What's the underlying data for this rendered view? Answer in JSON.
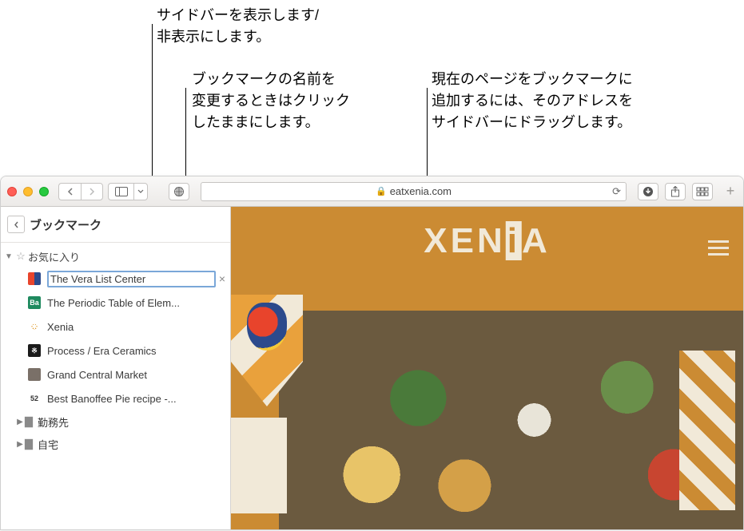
{
  "callouts": {
    "sidebar_toggle": "サイドバーを表示します/\n非表示にします。",
    "rename_bookmark": "ブックマークの名前を\n変更するときはクリック\nしたままにします。",
    "drag_to_sidebar": "現在のページをブックマークに\n追加するには、そのアドレスを\nサイドバーにドラッグします。"
  },
  "toolbar": {
    "address": "eatxenia.com"
  },
  "sidebar": {
    "title": "ブックマーク",
    "favorites_label": "お気に入り",
    "bookmarks": [
      {
        "label": "The Vera List Center",
        "icon_bg": "linear-gradient(90deg,#e8442c 50%,#2c4a8c 50%)",
        "editing": true
      },
      {
        "label": "The Periodic Table of Elem...",
        "icon_bg": "#1f8a5f",
        "icon_txt": "Ba"
      },
      {
        "label": "Xenia",
        "icon_bg": "radial-gradient(circle,#e09a2a 30%,#fff 30%)",
        "icon_txt": "✱"
      },
      {
        "label": "Process / Era Ceramics",
        "icon_bg": "#1a1a1a",
        "icon_txt": "※"
      },
      {
        "label": "Grand Central Market",
        "icon_bg": "#7a7068",
        "icon_txt": ""
      },
      {
        "label": "Best Banoffee Pie recipe -...",
        "icon_bg": "#fff",
        "icon_txt": "52",
        "icon_color": "#333"
      }
    ],
    "folders": [
      {
        "label": "勤務先"
      },
      {
        "label": "自宅"
      }
    ]
  },
  "content": {
    "logo": "XENIA"
  }
}
